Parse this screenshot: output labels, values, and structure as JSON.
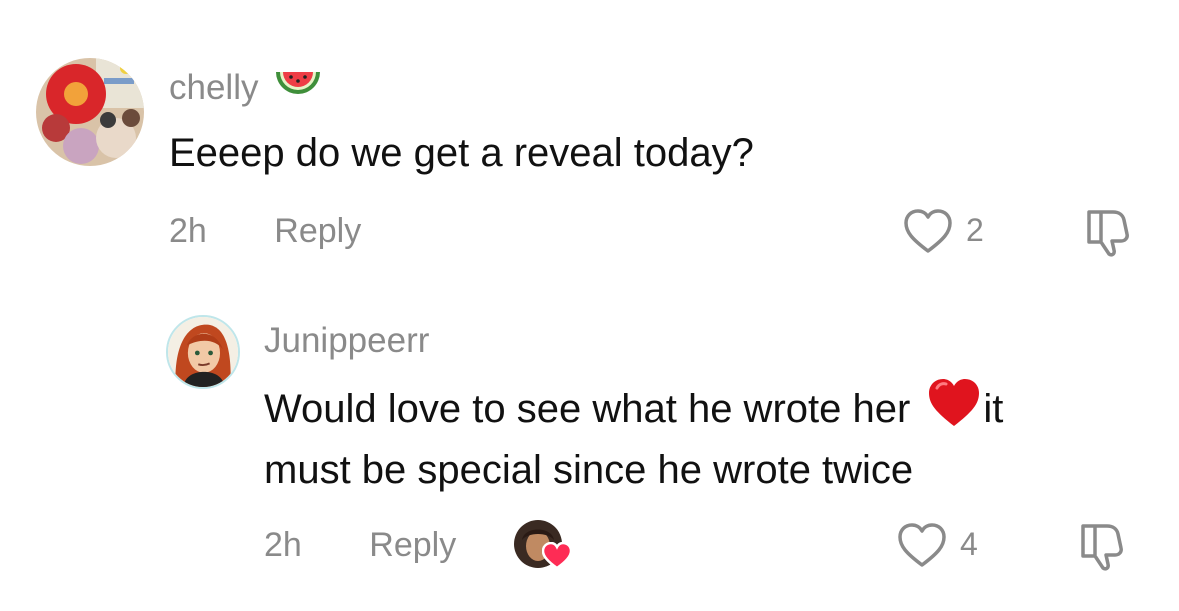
{
  "comments": [
    {
      "username": "chelly",
      "username_emoji": "watermelon-icon",
      "text": "Eeeep do we get a reveal today?",
      "time": "2h",
      "reply_label": "Reply",
      "likes": "2"
    },
    {
      "username": "Junippeerr",
      "text_line1": "Would love to see what he wrote her",
      "text_line1_after": "it",
      "text_line2": "must be special since he wrote twice",
      "inline_emoji": "red-heart-icon",
      "time": "2h",
      "reply_label": "Reply",
      "creator_liked": true,
      "likes": "4"
    }
  ],
  "colors": {
    "muted": "#8a8a8a",
    "text": "#111111",
    "heart_red": "#e0141e",
    "like_badge": "#fe2c55"
  }
}
